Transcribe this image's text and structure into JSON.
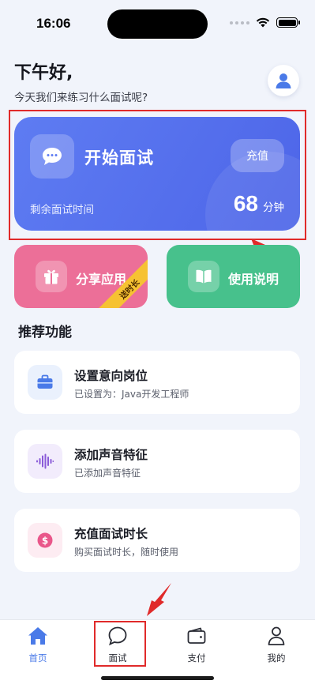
{
  "status_bar": {
    "time": "16:06"
  },
  "greeting": {
    "title": "下午好,",
    "subtitle": "今天我们来练习什么面试呢?",
    "avatar_icon": "user-icon"
  },
  "hero": {
    "icon": "chat-bubble-icon",
    "title": "开始面试",
    "recharge_label": "充值",
    "remaining_label": "剩余面试时间",
    "minutes_value": "68",
    "minutes_unit": "分钟"
  },
  "actions": {
    "share": {
      "icon": "gift-icon",
      "label": "分享应用",
      "ribbon": "送时长"
    },
    "guide": {
      "icon": "book-icon",
      "label": "使用说明"
    }
  },
  "recommended": {
    "title": "推荐功能",
    "items": [
      {
        "icon": "briefcase-icon",
        "title": "设置意向岗位",
        "subtitle": "已设置为：Java开发工程师"
      },
      {
        "icon": "waveform-icon",
        "title": "添加声音特征",
        "subtitle": "已添加声音特征"
      },
      {
        "icon": "dollar-icon",
        "title": "充值面试时长",
        "subtitle": "购买面试时长，随时使用"
      }
    ]
  },
  "tabbar": {
    "tabs": [
      {
        "icon": "home-icon",
        "label": "首页",
        "active": true
      },
      {
        "icon": "chat-icon",
        "label": "面试"
      },
      {
        "icon": "wallet-icon",
        "label": "支付"
      },
      {
        "icon": "person-icon",
        "label": "我的"
      }
    ]
  },
  "colors": {
    "hero": "#5470ee",
    "share": "#ec6f98",
    "guide": "#47c18c",
    "accent_tab": "#4a7ae8",
    "annotation_red": "#e02a2a"
  }
}
